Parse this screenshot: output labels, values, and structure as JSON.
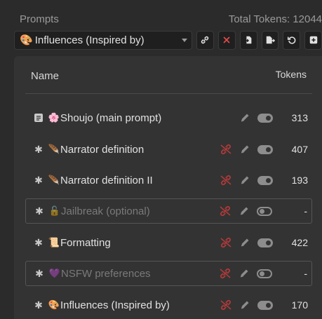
{
  "header": {
    "title": "Prompts",
    "total_tokens": "Total Tokens: 12044"
  },
  "toolbar": {
    "select_emoji": "🎨",
    "select_value": "Influences (Inspired by)",
    "buttons": [
      "link-icon",
      "close-icon",
      "import-icon",
      "export-icon",
      "reset-icon",
      "add-icon"
    ]
  },
  "table": {
    "col_name": "Name",
    "col_tokens": "Tokens",
    "rows": [
      {
        "emoji": "🌸",
        "title": "Shoujo (main prompt)",
        "tokens": "313",
        "enabled": true,
        "lead": "doc",
        "unlink": false
      },
      {
        "emoji": "🪶",
        "title": "Narrator definition",
        "tokens": "407",
        "enabled": true,
        "lead": "asterisk",
        "unlink": true
      },
      {
        "emoji": "🪶",
        "title": "Narrator definition II",
        "tokens": "193",
        "enabled": true,
        "lead": "asterisk",
        "unlink": true
      },
      {
        "emoji": "🔓",
        "title": "Jailbreak (optional)",
        "tokens": "-",
        "enabled": false,
        "lead": "asterisk",
        "unlink": true
      },
      {
        "emoji": "📜",
        "title": "Formatting",
        "tokens": "422",
        "enabled": true,
        "lead": "asterisk",
        "unlink": true
      },
      {
        "emoji": "💜",
        "title": "NSFW preferences",
        "tokens": "-",
        "enabled": false,
        "lead": "asterisk",
        "unlink": true
      },
      {
        "emoji": "🎨",
        "title": "Influences (Inspired by)",
        "tokens": "170",
        "enabled": true,
        "lead": "asterisk",
        "unlink": true
      }
    ]
  },
  "colors": {
    "background": "#2b2b2b",
    "panel": "#333333",
    "unlink_red": "#b03a3a",
    "toggle": "#8d8d8d"
  }
}
